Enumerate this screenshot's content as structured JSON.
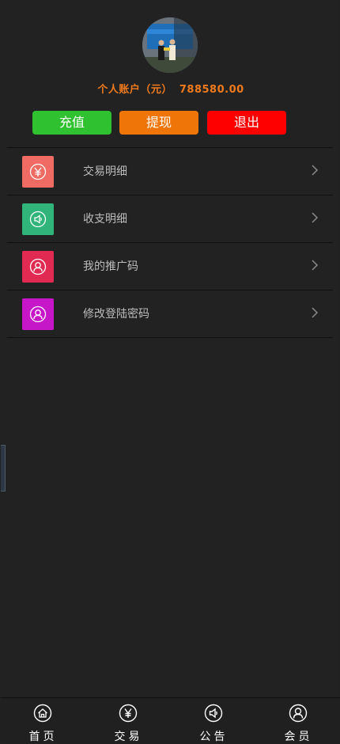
{
  "account": {
    "label": "个人账户（元）",
    "amount": "788580.00",
    "color": "#f07a1e"
  },
  "actions": [
    {
      "label": "充值",
      "color": "#2fc12f"
    },
    {
      "label": "提现",
      "color": "#f07508"
    },
    {
      "label": "退出",
      "color": "#fe0000"
    }
  ],
  "menu": [
    {
      "label": "交易明细",
      "icon": "yen-icon",
      "color": "#ef6b63"
    },
    {
      "label": "收支明细",
      "icon": "speaker-icon",
      "color": "#30b47a"
    },
    {
      "label": "我的推广码",
      "icon": "user-icon",
      "color": "#e02a52"
    },
    {
      "label": "修改登陆密码",
      "icon": "user-icon",
      "color": "#c516c8"
    }
  ],
  "tabs": [
    {
      "label": "首页",
      "icon": "home-icon"
    },
    {
      "label": "交易",
      "icon": "yen-icon"
    },
    {
      "label": "公告",
      "icon": "speaker-icon"
    },
    {
      "label": "会员",
      "icon": "user-icon"
    }
  ]
}
